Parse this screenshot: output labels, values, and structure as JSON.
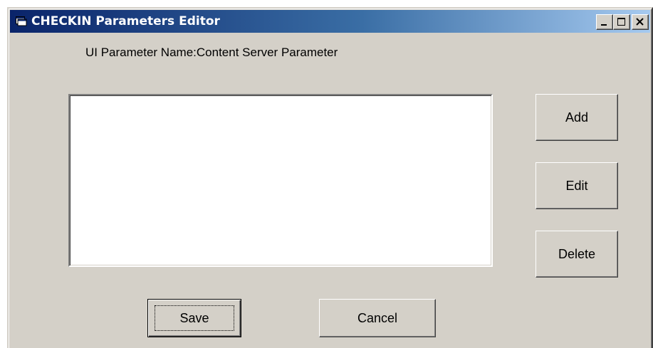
{
  "window": {
    "title": "CHECKIN Parameters Editor",
    "icon": "app-window-icon",
    "controls": {
      "minimize": "minimize-icon",
      "maximize": "maximize-icon",
      "close": "close-icon"
    }
  },
  "form": {
    "param_label": "UI Parameter Name:Content Server Parameter",
    "list_items": []
  },
  "buttons": {
    "add": "Add",
    "edit": "Edit",
    "delete": "Delete",
    "save": "Save",
    "cancel": "Cancel"
  },
  "colors": {
    "titlebar_start": "#0a246a",
    "titlebar_end": "#a6caf0",
    "face": "#d4d0c8"
  }
}
